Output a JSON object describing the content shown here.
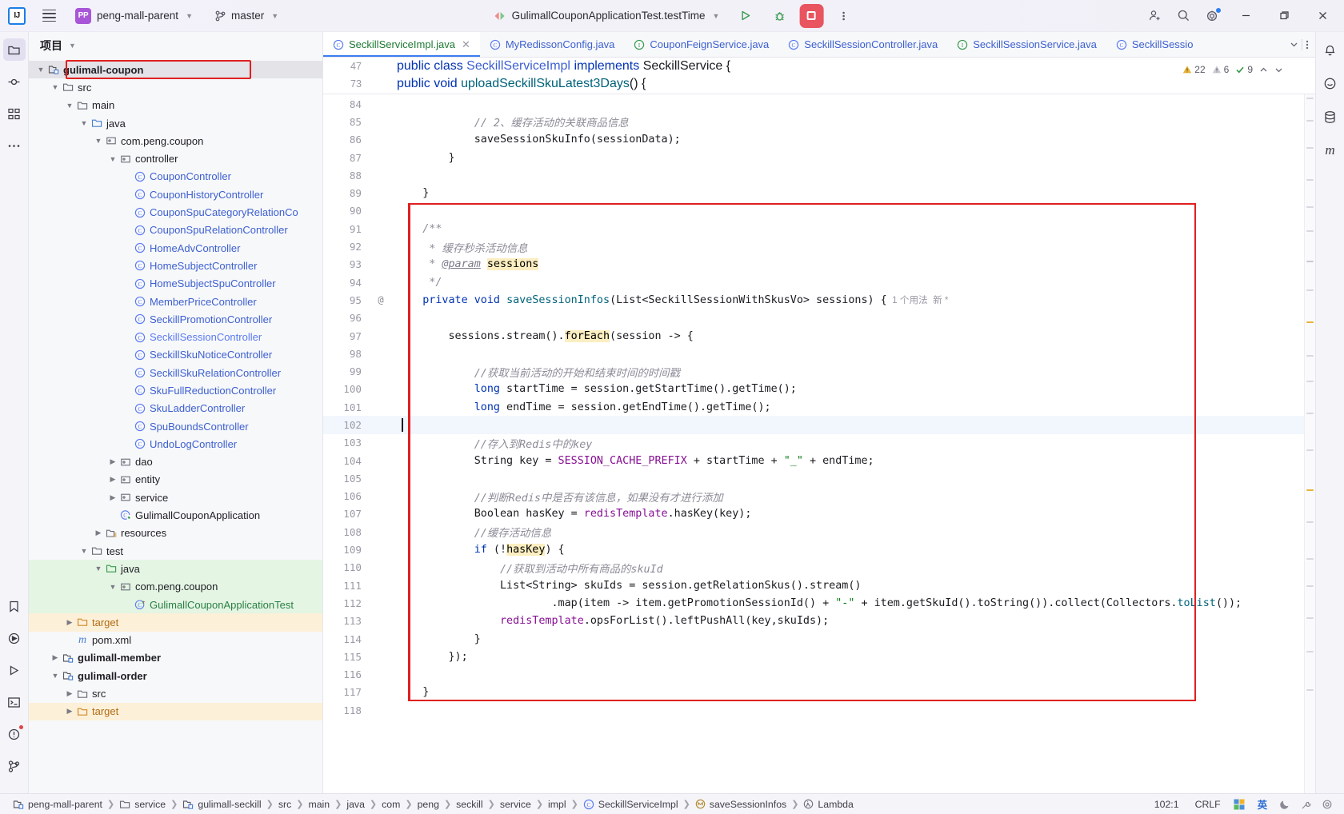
{
  "titlebar": {
    "logo": "IJ",
    "menu_icon": "hamburger-icon",
    "project_initials": "PP",
    "project_name": "peng-mall-parent",
    "branch_icon": "git-branch-icon",
    "branch_name": "master",
    "run_config": "GulimallCouponApplicationTest.testTime",
    "run_icon": "run-icon",
    "debug_icon": "debug-icon",
    "stop_icon": "stop-icon",
    "more_icon": "more-vertical-icon",
    "share_icon": "add-user-icon",
    "search_icon": "search-icon",
    "settings_icon": "gear-icon",
    "minimize_icon": "minimize-icon",
    "maximize_icon": "maximize-icon",
    "close_icon": "close-icon"
  },
  "left_rail": [
    {
      "name": "project-tool-window",
      "icon": "folder-icon"
    },
    {
      "name": "commit-tool-window",
      "icon": "commit-icon"
    },
    {
      "name": "structure-tool-window",
      "icon": "structure-icon"
    },
    {
      "name": "more-tool-windows",
      "icon": "ellipsis-icon"
    },
    {
      "name": "bookmarks-tool-window",
      "icon": "tag-icon"
    },
    {
      "name": "debug-tool-window",
      "icon": "debug-circle-icon"
    },
    {
      "name": "run-tool-window",
      "icon": "run-triangle-icon"
    },
    {
      "name": "terminal-tool-window",
      "icon": "terminal-icon"
    },
    {
      "name": "problems-tool-window",
      "icon": "warning-circle-icon"
    },
    {
      "name": "version-control-tool-window",
      "icon": "vcs-branch-icon"
    }
  ],
  "right_rail": [
    {
      "name": "notifications",
      "icon": "bell-icon"
    },
    {
      "name": "ai-assistant",
      "icon": "ai-icon"
    },
    {
      "name": "database",
      "icon": "database-icon"
    },
    {
      "name": "maven",
      "icon": "maven-m-icon"
    }
  ],
  "project_panel": {
    "title": "项目",
    "title_chevron": "chevron-down-icon",
    "highlight_color": "#e02020",
    "tree": [
      {
        "depth": 1,
        "arrow": "down",
        "icon": "module-icon",
        "label": "gulimall-coupon",
        "style": "bold",
        "selected": true,
        "boxed": true
      },
      {
        "depth": 2,
        "arrow": "down",
        "icon": "folder-icon",
        "label": "src",
        "style": "plain"
      },
      {
        "depth": 3,
        "arrow": "down",
        "icon": "folder-icon",
        "label": "main",
        "style": "plain"
      },
      {
        "depth": 4,
        "arrow": "down",
        "icon": "source-folder-icon",
        "label": "java",
        "style": "plain"
      },
      {
        "depth": 5,
        "arrow": "down",
        "icon": "package-icon",
        "label": "com.peng.coupon",
        "style": "plain"
      },
      {
        "depth": 6,
        "arrow": "down",
        "icon": "package-icon",
        "label": "controller",
        "style": "plain"
      },
      {
        "depth": 7,
        "arrow": "none",
        "icon": "java-class-icon",
        "label": "CouponController",
        "style": "class"
      },
      {
        "depth": 7,
        "arrow": "none",
        "icon": "java-class-icon",
        "label": "CouponHistoryController",
        "style": "class"
      },
      {
        "depth": 7,
        "arrow": "none",
        "icon": "java-class-icon",
        "label": "CouponSpuCategoryRelationCo",
        "style": "class"
      },
      {
        "depth": 7,
        "arrow": "none",
        "icon": "java-class-icon",
        "label": "CouponSpuRelationController",
        "style": "class"
      },
      {
        "depth": 7,
        "arrow": "none",
        "icon": "java-class-icon",
        "label": "HomeAdvController",
        "style": "class"
      },
      {
        "depth": 7,
        "arrow": "none",
        "icon": "java-class-icon",
        "label": "HomeSubjectController",
        "style": "class"
      },
      {
        "depth": 7,
        "arrow": "none",
        "icon": "java-class-icon",
        "label": "HomeSubjectSpuController",
        "style": "class"
      },
      {
        "depth": 7,
        "arrow": "none",
        "icon": "java-class-icon",
        "label": "MemberPriceController",
        "style": "class"
      },
      {
        "depth": 7,
        "arrow": "none",
        "icon": "java-class-icon",
        "label": "SeckillPromotionController",
        "style": "class"
      },
      {
        "depth": 7,
        "arrow": "none",
        "icon": "java-class-icon",
        "label": "SeckillSessionController",
        "style": "class-open"
      },
      {
        "depth": 7,
        "arrow": "none",
        "icon": "java-class-icon",
        "label": "SeckillSkuNoticeController",
        "style": "class"
      },
      {
        "depth": 7,
        "arrow": "none",
        "icon": "java-class-icon",
        "label": "SeckillSkuRelationController",
        "style": "class"
      },
      {
        "depth": 7,
        "arrow": "none",
        "icon": "java-class-icon",
        "label": "SkuFullReductionController",
        "style": "class"
      },
      {
        "depth": 7,
        "arrow": "none",
        "icon": "java-class-icon",
        "label": "SkuLadderController",
        "style": "class"
      },
      {
        "depth": 7,
        "arrow": "none",
        "icon": "java-class-icon",
        "label": "SpuBoundsController",
        "style": "class"
      },
      {
        "depth": 7,
        "arrow": "none",
        "icon": "java-class-icon",
        "label": "UndoLogController",
        "style": "class"
      },
      {
        "depth": 6,
        "arrow": "right",
        "icon": "package-icon",
        "label": "dao",
        "style": "plain"
      },
      {
        "depth": 6,
        "arrow": "right",
        "icon": "package-icon",
        "label": "entity",
        "style": "plain"
      },
      {
        "depth": 6,
        "arrow": "right",
        "icon": "package-icon",
        "label": "service",
        "style": "plain"
      },
      {
        "depth": 6,
        "arrow": "none",
        "icon": "spring-boot-class-icon",
        "label": "GulimallCouponApplication",
        "style": "plain"
      },
      {
        "depth": 5,
        "arrow": "right",
        "icon": "resources-folder-icon",
        "label": "resources",
        "style": "plain"
      },
      {
        "depth": 4,
        "arrow": "down",
        "icon": "folder-icon",
        "label": "test",
        "style": "plain"
      },
      {
        "depth": 5,
        "arrow": "down",
        "icon": "test-source-folder-icon",
        "label": "java",
        "style": "plain",
        "row_bg": "green"
      },
      {
        "depth": 6,
        "arrow": "down",
        "icon": "package-icon",
        "label": "com.peng.coupon",
        "style": "plain",
        "row_bg": "green"
      },
      {
        "depth": 7,
        "arrow": "none",
        "icon": "test-class-icon",
        "label": "GulimallCouponApplicationTest",
        "style": "greentext",
        "row_bg": "green"
      },
      {
        "depth": 3,
        "arrow": "right",
        "icon": "excluded-folder-icon",
        "label": "target",
        "style": "orangetext",
        "row_bg": "orange"
      },
      {
        "depth": 3,
        "arrow": "none",
        "icon": "maven-m-icon",
        "label": "pom.xml",
        "style": "plain"
      },
      {
        "depth": 2,
        "arrow": "right",
        "icon": "module-icon",
        "label": "gulimall-member",
        "style": "bold"
      },
      {
        "depth": 2,
        "arrow": "down",
        "icon": "module-icon",
        "label": "gulimall-order",
        "style": "bold"
      },
      {
        "depth": 3,
        "arrow": "right",
        "icon": "folder-icon",
        "label": "src",
        "style": "plain"
      },
      {
        "depth": 3,
        "arrow": "right",
        "icon": "excluded-folder-icon",
        "label": "target",
        "style": "orangetext",
        "row_bg": "orange"
      }
    ]
  },
  "editor_tabs": [
    {
      "label": "SeckillServiceImpl.java",
      "icon": "java-class-icon",
      "active": true,
      "closable": true
    },
    {
      "label": "MyRedissonConfig.java",
      "icon": "java-class-icon",
      "active": false
    },
    {
      "label": "CouponFeignService.java",
      "icon": "java-interface-icon",
      "active": false
    },
    {
      "label": "SeckillSessionController.java",
      "icon": "java-class-icon",
      "active": false
    },
    {
      "label": "SeckillSessionService.java",
      "icon": "java-interface-icon",
      "active": false
    },
    {
      "label": "SeckillSessio",
      "icon": "java-class-icon",
      "active": false
    }
  ],
  "tabs_overflow_icon": "chevron-down-icon",
  "tabs_options_icon": "more-vertical-icon",
  "inspection": {
    "warnings": "22",
    "weak_warnings": "6",
    "oks": "9",
    "warning_icon": "warning-triangle-icon",
    "weak_icon": "weak-warning-icon",
    "ok_icon": "check-icon",
    "prev_icon": "chevron-up-icon",
    "next_icon": "chevron-down-icon"
  },
  "sticky_lines": [
    {
      "num": "47",
      "indent": 4,
      "tokens": [
        {
          "t": "public",
          "c": "kw"
        },
        {
          "t": " ",
          "c": "pln"
        },
        {
          "t": "class",
          "c": "kw"
        },
        {
          "t": " ",
          "c": "pln"
        },
        {
          "t": "SeckillServiceImpl",
          "c": "cls"
        },
        {
          "t": " ",
          "c": "pln"
        },
        {
          "t": "implements",
          "c": "kw"
        },
        {
          "t": " ",
          "c": "pln"
        },
        {
          "t": "SeckillService",
          "c": "pln"
        },
        {
          "t": " {",
          "c": "pln"
        }
      ]
    },
    {
      "num": "73",
      "indent": 8,
      "tokens": [
        {
          "t": "public",
          "c": "kw"
        },
        {
          "t": " ",
          "c": "pln"
        },
        {
          "t": "void",
          "c": "kw"
        },
        {
          "t": " ",
          "c": "pln"
        },
        {
          "t": "uploadSeckillSkuLatest3Days",
          "c": "mth"
        },
        {
          "t": "() {",
          "c": "pln"
        }
      ]
    }
  ],
  "code_lines": [
    {
      "num": "84",
      "tokens": []
    },
    {
      "num": "85",
      "tokens": [
        {
          "t": "            // 2、缓存活动的关联商品信息",
          "c": "cmt"
        }
      ]
    },
    {
      "num": "86",
      "tokens": [
        {
          "t": "            ",
          "c": "pln"
        },
        {
          "t": "saveSessionSkuInfo",
          "c": "pln"
        },
        {
          "t": "(sessionData);",
          "c": "pln"
        }
      ]
    },
    {
      "num": "87",
      "tokens": [
        {
          "t": "        }",
          "c": "pln"
        }
      ]
    },
    {
      "num": "88",
      "tokens": []
    },
    {
      "num": "89",
      "tokens": [
        {
          "t": "    }",
          "c": "pln"
        }
      ]
    },
    {
      "num": "90",
      "tokens": []
    },
    {
      "num": "91",
      "tokens": [
        {
          "t": "    /**",
          "c": "cmt"
        }
      ]
    },
    {
      "num": "92",
      "tokens": [
        {
          "t": "     * 缓存秒杀活动信息",
          "c": "cmt"
        }
      ]
    },
    {
      "num": "93",
      "tokens": [
        {
          "t": "     * ",
          "c": "cmt"
        },
        {
          "t": "@param",
          "c": "tagu"
        },
        {
          "t": " ",
          "c": "pln"
        },
        {
          "t": "sessions",
          "c": "hl"
        }
      ]
    },
    {
      "num": "94",
      "tokens": [
        {
          "t": "     */",
          "c": "cmt"
        }
      ]
    },
    {
      "num": "95",
      "mark": "@",
      "tokens": [
        {
          "t": "    ",
          "c": "pln"
        },
        {
          "t": "private",
          "c": "kw"
        },
        {
          "t": " ",
          "c": "pln"
        },
        {
          "t": "void",
          "c": "kw"
        },
        {
          "t": " ",
          "c": "pln"
        },
        {
          "t": "saveSessionInfos",
          "c": "mth"
        },
        {
          "t": "(List<SeckillSessionWithSkusVo> sessions) {",
          "c": "pln"
        },
        {
          "t": "  1 个用法  新 *",
          "c": "hint"
        }
      ]
    },
    {
      "num": "96",
      "tokens": []
    },
    {
      "num": "97",
      "tokens": [
        {
          "t": "        sessions.stream().",
          "c": "pln"
        },
        {
          "t": "forEach",
          "c": "hl"
        },
        {
          "t": "(session -> {",
          "c": "pln"
        }
      ]
    },
    {
      "num": "98",
      "tokens": []
    },
    {
      "num": "99",
      "tokens": [
        {
          "t": "            //获取当前活动的开始和结束时间的时间戳",
          "c": "cmt"
        }
      ]
    },
    {
      "num": "100",
      "tokens": [
        {
          "t": "            ",
          "c": "pln"
        },
        {
          "t": "long",
          "c": "kw"
        },
        {
          "t": " startTime = session.getStartTime().getTime();",
          "c": "pln"
        }
      ]
    },
    {
      "num": "101",
      "tokens": [
        {
          "t": "            ",
          "c": "pln"
        },
        {
          "t": "long",
          "c": "kw"
        },
        {
          "t": " endTime = session.getEndTime().getTime();",
          "c": "pln"
        }
      ]
    },
    {
      "num": "102",
      "current": true,
      "tokens": []
    },
    {
      "num": "103",
      "tokens": [
        {
          "t": "            //存入到Redis中的key",
          "c": "cmt"
        }
      ]
    },
    {
      "num": "104",
      "tokens": [
        {
          "t": "            String key = ",
          "c": "pln"
        },
        {
          "t": "SESSION_CACHE_PREFIX",
          "c": "fld"
        },
        {
          "t": " + startTime + ",
          "c": "pln"
        },
        {
          "t": "\"_\"",
          "c": "str"
        },
        {
          "t": " + endTime;",
          "c": "pln"
        }
      ]
    },
    {
      "num": "105",
      "tokens": []
    },
    {
      "num": "106",
      "tokens": [
        {
          "t": "            //判断Redis中是否有该信息，如果没有才进行添加",
          "c": "cmt"
        }
      ]
    },
    {
      "num": "107",
      "tokens": [
        {
          "t": "            Boolean hasKey = ",
          "c": "pln"
        },
        {
          "t": "redisTemplate",
          "c": "fld"
        },
        {
          "t": ".hasKey(key);",
          "c": "pln"
        }
      ]
    },
    {
      "num": "108",
      "tokens": [
        {
          "t": "            //缓存活动信息",
          "c": "cmt"
        }
      ]
    },
    {
      "num": "109",
      "tokens": [
        {
          "t": "            ",
          "c": "pln"
        },
        {
          "t": "if",
          "c": "kw"
        },
        {
          "t": " (!",
          "c": "pln"
        },
        {
          "t": "hasKey",
          "c": "hl"
        },
        {
          "t": ") {",
          "c": "pln"
        }
      ]
    },
    {
      "num": "110",
      "tokens": [
        {
          "t": "                //获取到活动中所有商品的skuId",
          "c": "cmt"
        }
      ]
    },
    {
      "num": "111",
      "tokens": [
        {
          "t": "                List<String> skuIds = session.getRelationSkus().stream()",
          "c": "pln"
        }
      ]
    },
    {
      "num": "112",
      "tokens": [
        {
          "t": "                        .map(item -> item.getPromotionSessionId() + ",
          "c": "pln"
        },
        {
          "t": "\"-\"",
          "c": "str"
        },
        {
          "t": " + item.getSkuId().toString()).collect(Collectors.",
          "c": "pln"
        },
        {
          "t": "toList",
          "c": "mth"
        },
        {
          "t": "());",
          "c": "pln"
        }
      ]
    },
    {
      "num": "113",
      "tokens": [
        {
          "t": "                ",
          "c": "pln"
        },
        {
          "t": "redisTemplate",
          "c": "fld"
        },
        {
          "t": ".opsForList().leftPushAll(key,skuIds);",
          "c": "pln"
        }
      ]
    },
    {
      "num": "114",
      "tokens": [
        {
          "t": "            }",
          "c": "pln"
        }
      ]
    },
    {
      "num": "115",
      "tokens": [
        {
          "t": "        });",
          "c": "pln"
        }
      ]
    },
    {
      "num": "116",
      "tokens": []
    },
    {
      "num": "117",
      "tokens": [
        {
          "t": "    }",
          "c": "pln"
        }
      ]
    },
    {
      "num": "118",
      "tokens": []
    }
  ],
  "status_bar": {
    "breadcrumbs": [
      {
        "label": "peng-mall-parent",
        "icon": "module-icon"
      },
      {
        "label": "service",
        "icon": "folder-icon"
      },
      {
        "label": "gulimall-seckill",
        "icon": "module-icon"
      },
      {
        "label": "src",
        "icon": "none"
      },
      {
        "label": "main",
        "icon": "none"
      },
      {
        "label": "java",
        "icon": "none"
      },
      {
        "label": "com",
        "icon": "none"
      },
      {
        "label": "peng",
        "icon": "none"
      },
      {
        "label": "seckill",
        "icon": "none"
      },
      {
        "label": "service",
        "icon": "none"
      },
      {
        "label": "impl",
        "icon": "none"
      },
      {
        "label": "SeckillServiceImpl",
        "icon": "java-class-icon"
      },
      {
        "label": "saveSessionInfos",
        "icon": "method-icon"
      },
      {
        "label": "Lambda",
        "icon": "lambda-icon"
      }
    ],
    "caret_position": "102:1",
    "line_separator": "CRLF",
    "ime_layout_icon": "layout-icon",
    "ime_language": "英",
    "ime_moon_icon": "moon-icon",
    "ime_tools_icon": "tools-icon",
    "ime_settings_icon": "gear-small-icon"
  }
}
